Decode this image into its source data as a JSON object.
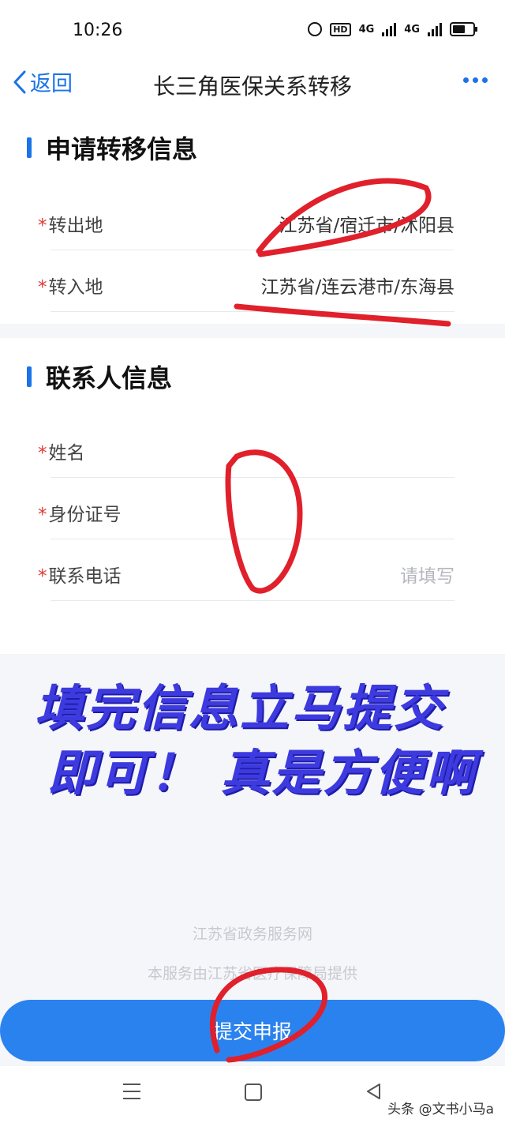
{
  "status": {
    "time": "10:26",
    "hd": "HD",
    "net1": "4G",
    "net2": "4G"
  },
  "nav": {
    "back_label": "返回",
    "title": "长三角医保关系转移"
  },
  "transfer": {
    "section_title": "申请转移信息",
    "rows": [
      {
        "label": "转出地",
        "value": "江苏省/宿迁市/沭阳县"
      },
      {
        "label": "转入地",
        "value": "江苏省/连云港市/东海县"
      }
    ]
  },
  "contact": {
    "section_title": "联系人信息",
    "rows": [
      {
        "label": "姓名",
        "value": ""
      },
      {
        "label": "身份证号",
        "value": ""
      },
      {
        "label": "联系电话",
        "placeholder": "请填写"
      }
    ]
  },
  "required_mark": "*",
  "overlay": {
    "line1": "填完信息立马提交",
    "line2": "即可！ 真是方便啊"
  },
  "footer": {
    "site": "江苏省政务服务网",
    "provider": "本服务由江苏省医疗保障局提供"
  },
  "submit_label": "提交申报",
  "watermark": "头条 @文书小马a",
  "colors": {
    "accent": "#1a73e8",
    "button": "#2a82ef",
    "overlay_text": "#3d3ae0",
    "annotation": "#e0202b"
  }
}
